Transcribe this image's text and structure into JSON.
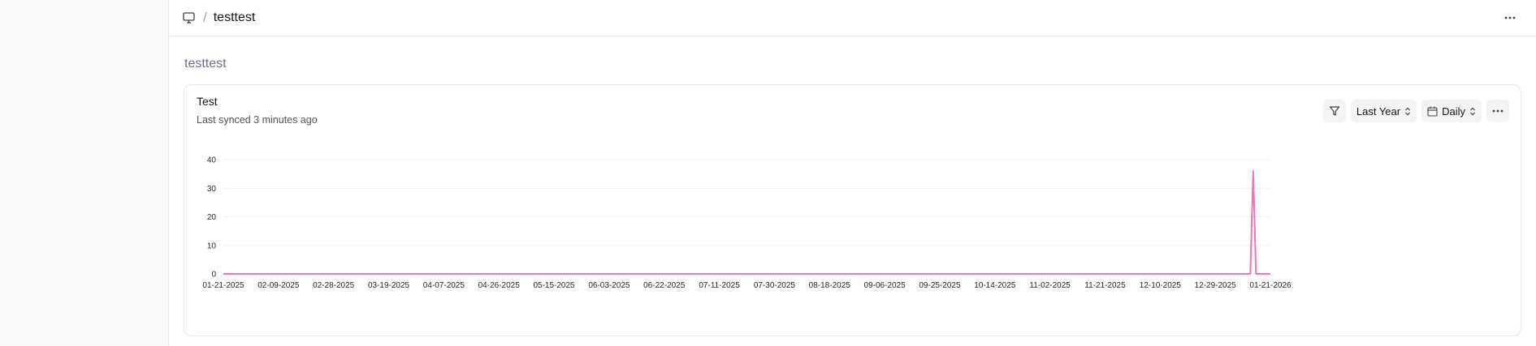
{
  "breadcrumb": {
    "icon": "monitor-icon",
    "separator": "/",
    "title": "testtest"
  },
  "page": {
    "heading": "testtest"
  },
  "card": {
    "title": "Test",
    "subtitle": "Last synced 3 minutes ago",
    "controls": {
      "filter_icon": "filter-icon",
      "range_label": "Last Year",
      "interval_label": "Daily",
      "calendar_icon": "calendar-icon",
      "more_icon": "more-horizontal-icon"
    }
  },
  "colors": {
    "series": "#f472b6",
    "grid": "#f0f0f0"
  },
  "chart_data": {
    "type": "line",
    "title": "",
    "xlabel": "",
    "ylabel": "",
    "ylim": [
      0,
      40
    ],
    "yticks": [
      "0",
      "10",
      "20",
      "30",
      "40"
    ],
    "xticks": [
      "01-21-2025",
      "02-09-2025",
      "02-28-2025",
      "03-19-2025",
      "04-07-2025",
      "04-26-2025",
      "05-15-2025",
      "06-03-2025",
      "06-22-2025",
      "07-11-2025",
      "07-30-2025",
      "08-18-2025",
      "09-06-2025",
      "09-25-2025",
      "10-14-2025",
      "11-02-2025",
      "11-21-2025",
      "12-10-2025",
      "12-29-2025",
      "01-21-2026"
    ],
    "grid": true,
    "legend": "none",
    "series": [
      {
        "points": [
          [
            "01-21-2025",
            0
          ],
          [
            "01-14-2026",
            0
          ],
          [
            "01-15-2026",
            36
          ],
          [
            "01-16-2026",
            0
          ],
          [
            "01-21-2026",
            0
          ]
        ]
      }
    ]
  }
}
